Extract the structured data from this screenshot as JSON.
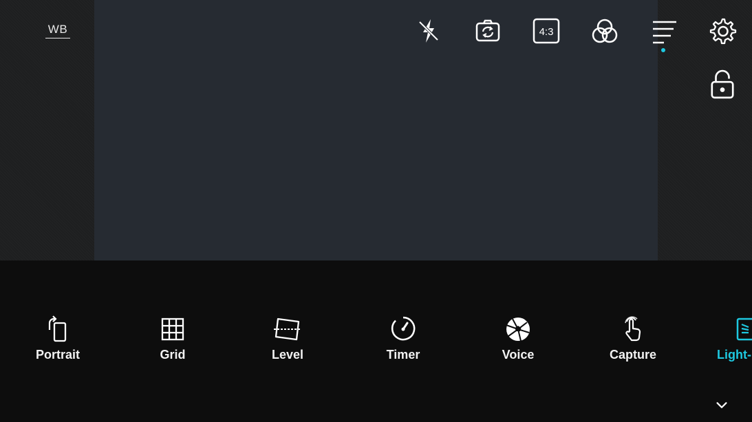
{
  "top_left": {
    "wb_label": "WB"
  },
  "top_bar": {
    "items": [
      {
        "icon": "flash-off-icon"
      },
      {
        "icon": "switch-camera-icon"
      },
      {
        "icon": "aspect-ratio-icon",
        "label": "4:3"
      },
      {
        "icon": "color-filter-icon"
      },
      {
        "icon": "menu-icon"
      },
      {
        "icon": "settings-gear-icon"
      }
    ],
    "accent": "#1ec8e0"
  },
  "side": {
    "lock_icon": "unlock-icon"
  },
  "tools": [
    {
      "label": "Portrait",
      "icon": "rotate-portrait-icon"
    },
    {
      "label": "Grid",
      "icon": "grid-icon"
    },
    {
      "label": "Level",
      "icon": "level-icon"
    },
    {
      "label": "Timer",
      "icon": "timer-icon"
    },
    {
      "label": "Voice",
      "icon": "shutter-icon"
    },
    {
      "label": "Capture",
      "icon": "touch-capture-icon"
    },
    {
      "label": "Light-",
      "icon": "light-icon",
      "active": true
    }
  ],
  "bottom": {
    "collapse_icon": "chevron-down-icon"
  }
}
